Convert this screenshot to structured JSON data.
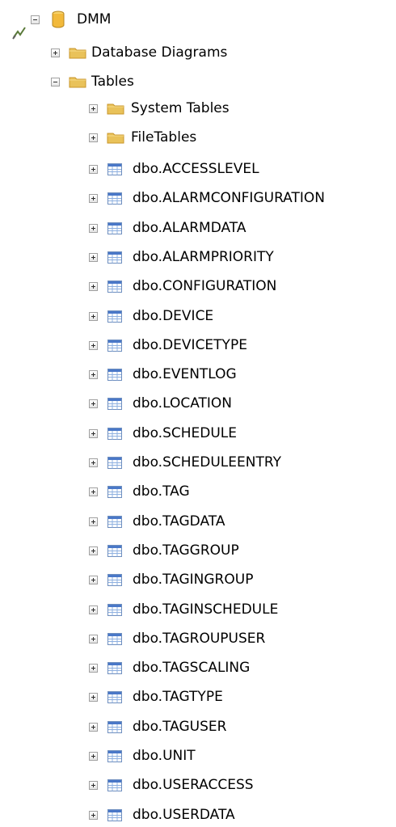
{
  "tree": {
    "root": {
      "label": "DMM",
      "state": "expanded",
      "icon": "database-icon",
      "connection_icon": "connection-icon"
    },
    "folders": [
      {
        "label": "Database Diagrams",
        "state": "collapsed",
        "icon": "folder-icon"
      },
      {
        "label": "Tables",
        "state": "expanded",
        "icon": "folder-icon"
      }
    ],
    "table_folders": [
      {
        "label": "System Tables",
        "state": "collapsed",
        "icon": "folder-icon"
      },
      {
        "label": "FileTables",
        "state": "collapsed",
        "icon": "folder-icon"
      }
    ],
    "tables": [
      {
        "label": "dbo.ACCESSLEVEL"
      },
      {
        "label": "dbo.ALARMCONFIGURATION"
      },
      {
        "label": "dbo.ALARMDATA"
      },
      {
        "label": "dbo.ALARMPRIORITY"
      },
      {
        "label": "dbo.CONFIGURATION"
      },
      {
        "label": "dbo.DEVICE"
      },
      {
        "label": "dbo.DEVICETYPE"
      },
      {
        "label": "dbo.EVENTLOG"
      },
      {
        "label": "dbo.LOCATION"
      },
      {
        "label": "dbo.SCHEDULE"
      },
      {
        "label": "dbo.SCHEDULEENTRY"
      },
      {
        "label": "dbo.TAG"
      },
      {
        "label": "dbo.TAGDATA"
      },
      {
        "label": "dbo.TAGGROUP"
      },
      {
        "label": "dbo.TAGINGROUP"
      },
      {
        "label": "dbo.TAGINSCHEDULE"
      },
      {
        "label": "dbo.TAGROUPUSER"
      },
      {
        "label": "dbo.TAGSCALING"
      },
      {
        "label": "dbo.TAGTYPE"
      },
      {
        "label": "dbo.TAGUSER"
      },
      {
        "label": "dbo.UNIT"
      },
      {
        "label": "dbo.USERACCESS"
      },
      {
        "label": "dbo.USERDATA"
      }
    ],
    "colors": {
      "folder": "#e9c25a",
      "folder_dark": "#c9962a",
      "database": "#f2b93b",
      "table_icon": "#4a78c8"
    }
  }
}
